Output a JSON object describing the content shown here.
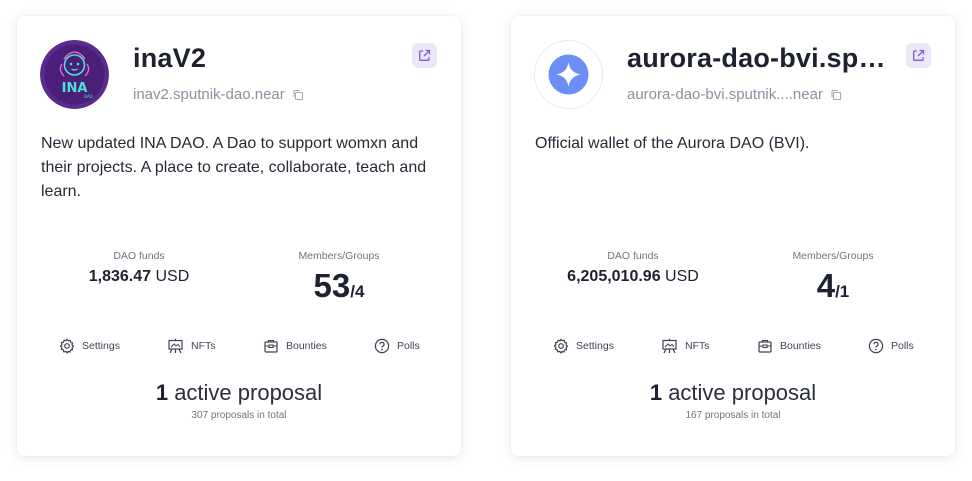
{
  "cards": [
    {
      "name": "inaV2",
      "address": "inav2.sputnik-dao.near",
      "avatar_text": "INA",
      "description": "New updated INA DAO. A Dao to support womxn and their projects. A place to create, collaborate, teach and learn.",
      "funds_label": "DAO funds",
      "funds_amount": "1,836.47",
      "funds_currency": "USD",
      "members_label": "Members/Groups",
      "members": "53",
      "groups": "/4",
      "actions": {
        "settings": "Settings",
        "nfts": "NFTs",
        "bounties": "Bounties",
        "polls": "Polls"
      },
      "active_count": "1",
      "active_label": "active proposal",
      "total_proposals": "307 proposals in total"
    },
    {
      "name": "aurora-dao-bvi.sputnik-dao.near",
      "address": "aurora-dao-bvi.sputnik....near",
      "description": "Official wallet of the Aurora DAO (BVI).",
      "funds_label": "DAO funds",
      "funds_amount": "6,205,010.96",
      "funds_currency": "USD",
      "members_label": "Members/Groups",
      "members": "4",
      "groups": "/1",
      "actions": {
        "settings": "Settings",
        "nfts": "NFTs",
        "bounties": "Bounties",
        "polls": "Polls"
      },
      "active_count": "1",
      "active_label": "active proposal",
      "total_proposals": "167 proposals in total"
    }
  ],
  "colors": {
    "accent": "#7b5cd6",
    "accent_bg": "#ece7f8",
    "ina_purple": "#5a2a8e",
    "ina_teal": "#4ee0d8",
    "aurora_blue": "#6d8ef6",
    "muted_text": "#8b909e"
  },
  "icons": [
    "external-link-icon",
    "copy-icon",
    "gear-icon",
    "nft-easel-icon",
    "bounty-box-icon",
    "help-circle-icon",
    "aurora-star-icon"
  ]
}
